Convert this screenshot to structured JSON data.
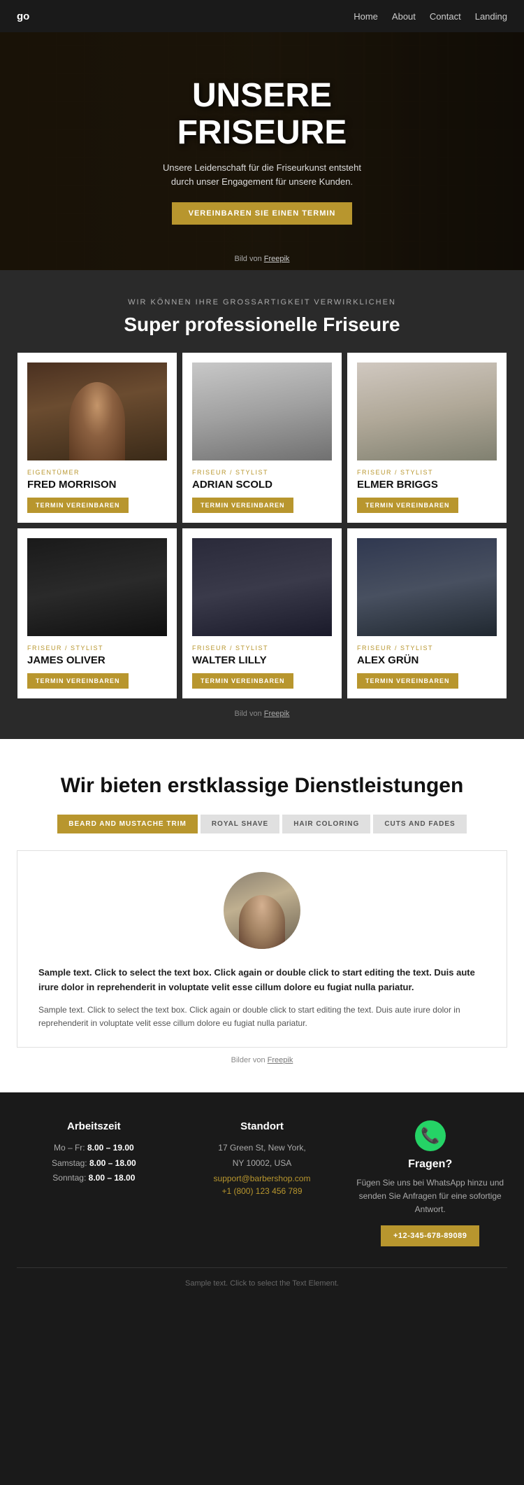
{
  "nav": {
    "logo": "go",
    "links": [
      {
        "label": "Home",
        "href": "#"
      },
      {
        "label": "About",
        "href": "#"
      },
      {
        "label": "Contact",
        "href": "#"
      },
      {
        "label": "Landing",
        "href": "#"
      }
    ]
  },
  "hero": {
    "title_line1": "UNSERE",
    "title_line2": "FRISEURE",
    "subtitle": "Unsere Leidenschaft für die Friseurkunst entsteht durch unser Engagement für unsere Kunden.",
    "cta_label": "VEREINBAREN SIE EINEN TERMIN",
    "credit_text": "Bild von",
    "credit_link": "Freepik"
  },
  "team": {
    "section_label": "WIR KÖNNEN IHRE GROSSARTIGKEIT VERWIRKLICHEN",
    "section_title": "Super professionelle Friseure",
    "members": [
      {
        "id": "fred",
        "role": "EIGENTÜMER",
        "name": "FRED MORRISON",
        "btn": "TERMIN VEREINBAREN"
      },
      {
        "id": "adrian",
        "role": "FRISEUR / STYLIST",
        "name": "ADRIAN SCOLD",
        "btn": "TERMIN VEREINBAREN"
      },
      {
        "id": "elmer",
        "role": "FRISEUR / STYLIST",
        "name": "ELMER BRIGGS",
        "btn": "TERMIN VEREINBAREN"
      },
      {
        "id": "james",
        "role": "FRISEUR / STYLIST",
        "name": "JAMES OLIVER",
        "btn": "TERMIN VEREINBAREN"
      },
      {
        "id": "walter",
        "role": "FRISEUR / STYLIST",
        "name": "WALTER LILLY",
        "btn": "TERMIN VEREINBAREN"
      },
      {
        "id": "alex",
        "role": "FRISEUR / STYLIST",
        "name": "ALEX GRÜN",
        "btn": "TERMIN VEREINBAREN"
      }
    ],
    "credit_text": "Bild von",
    "credit_link": "Freepik"
  },
  "services": {
    "section_title": "Wir bieten erstklassige Dienstleistungen",
    "tabs": [
      {
        "id": "beard",
        "label": "BEARD AND MUSTACHE TRIM",
        "active": true
      },
      {
        "id": "shave",
        "label": "ROYAL SHAVE",
        "active": false
      },
      {
        "id": "coloring",
        "label": "HAIR COLORING",
        "active": false
      },
      {
        "id": "cuts",
        "label": "CUTS AND FADES",
        "active": false
      }
    ],
    "content_text_bold": "Sample text. Click to select the text box. Click again or double click to start editing the text. Duis aute irure dolor in reprehenderit in voluptate velit esse cillum dolore eu fugiat nulla pariatur.",
    "content_text_normal": "Sample text. Click to select the text box. Click again or double click to start editing the text. Duis aute irure dolor in reprehenderit in voluptate velit esse cillum dolore eu fugiat nulla pariatur.",
    "credit_text": "Bilder von",
    "credit_link": "Freepik"
  },
  "footer": {
    "arbeitszeit": {
      "title": "Arbeitszeit",
      "rows": [
        {
          "label": "Mo – Fr:",
          "hours": "8.00 – 19.00"
        },
        {
          "label": "Samstag:",
          "hours": "8.00 – 18.00"
        },
        {
          "label": "Sonntag:",
          "hours": "8.00 – 18.00"
        }
      ]
    },
    "standort": {
      "title": "Standort",
      "address_line1": "17 Green St, New York,",
      "address_line2": "NY 10002, USA",
      "email": "support@barbershop.com",
      "phone": "+1 (800) 123 456 789"
    },
    "kontakt": {
      "fragen_title": "Fragen?",
      "fragen_text": "Fügen Sie uns bei WhatsApp hinzu und senden Sie Anfragen für eine sofortige Antwort.",
      "btn_label": "+12-345-678-89089"
    },
    "bottom_text": "Sample text. Click to select the Text Element."
  }
}
